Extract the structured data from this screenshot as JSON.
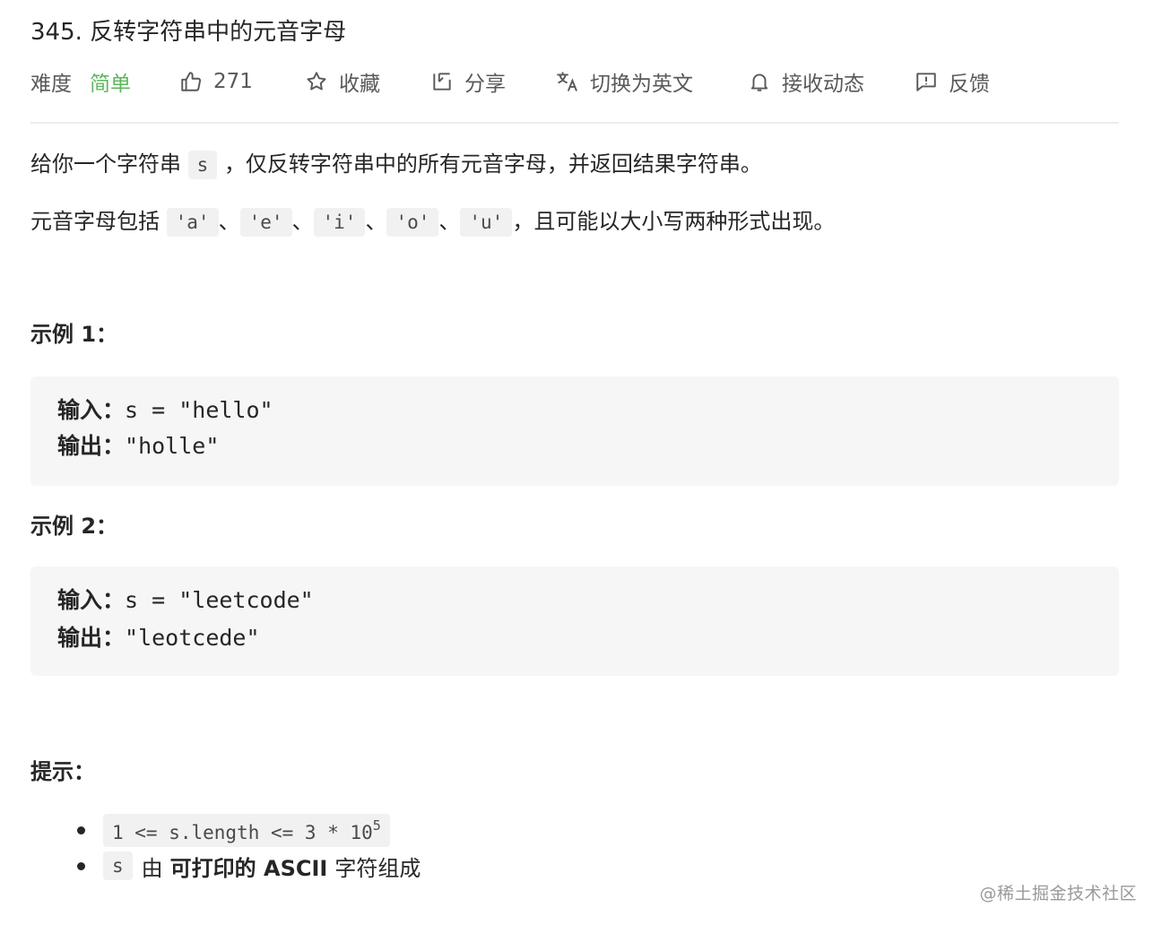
{
  "problem": {
    "title": "345. 反转字符串中的元音字母"
  },
  "meta": {
    "difficulty_label": "难度",
    "difficulty_value": "简单",
    "likes": "271",
    "favorite": "收藏",
    "share": "分享",
    "translate": "切换为英文",
    "notify": "接收动态",
    "feedback": "反馈"
  },
  "description": {
    "line1_pre": "给你一个字符串",
    "line1_code": "s",
    "line1_post": "，仅反转字符串中的所有元音字母，并返回结果字符串。",
    "line2_pre": "元音字母包括",
    "vowels": [
      "'a'",
      "'e'",
      "'i'",
      "'o'",
      "'u'"
    ],
    "separator": "、",
    "line2_post": "，且可能以大小写两种形式出现。"
  },
  "examples": [
    {
      "heading": "示例 1：",
      "input_label": "输入：",
      "input_value": "s = \"hello\"",
      "output_label": "输出：",
      "output_value": "\"holle\""
    },
    {
      "heading": "示例 2：",
      "input_label": "输入：",
      "input_value": "s = \"leetcode\"",
      "output_label": "输出：",
      "output_value": "\"leotcede\""
    }
  ],
  "hints": {
    "heading": "提示：",
    "item1_code": "1 <= s.length <= 3 * 10",
    "item1_sup": "5",
    "item2_code": "s",
    "item2_mid": "由",
    "item2_bold": "可打印的 ASCII",
    "item2_post": "字符组成"
  },
  "watermark": "@稀土掘金技术社区",
  "colors": {
    "easy": "#5cb85c",
    "code_bg": "#f1f1f1",
    "example_bg": "#f6f6f6"
  }
}
